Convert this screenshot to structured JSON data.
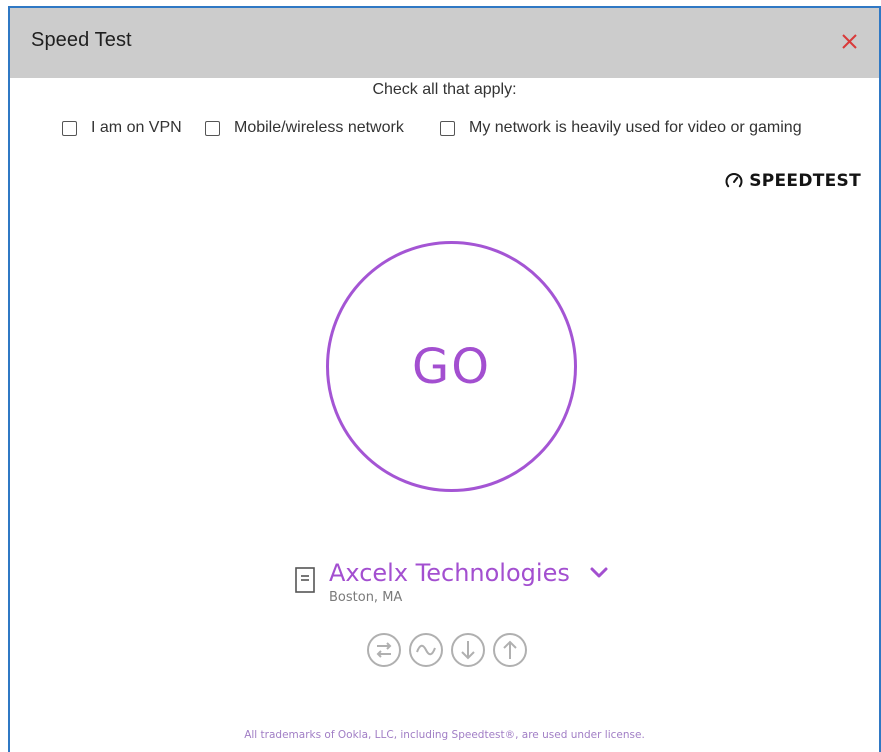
{
  "dialog": {
    "title": "Speed Test",
    "close_icon": "close-icon"
  },
  "instructions": "Check all that apply:",
  "options": [
    {
      "label": "I am on VPN",
      "checked": false
    },
    {
      "label": "Mobile/wireless network",
      "checked": false
    },
    {
      "label": "My network is heavily used for video or gaming",
      "checked": false
    }
  ],
  "brand": {
    "text": "SPEEDTEST",
    "mark": "˙",
    "icon": "speedometer-icon"
  },
  "go_button": {
    "label": "GO"
  },
  "server": {
    "name": "Axcelx Technologies",
    "location": "Boston, MA",
    "icon": "server-document-icon",
    "dropdown_icon": "chevron-down-icon"
  },
  "test_icons": [
    {
      "icon": "ping-icon"
    },
    {
      "icon": "jitter-icon"
    },
    {
      "icon": "download-icon"
    },
    {
      "icon": "upload-icon"
    }
  ],
  "footer": "All trademarks of Ookla, LLC, including Speedtest®, are used under license.",
  "colors": {
    "accent": "#a34fd0",
    "title_bar": "#cccccc",
    "window_border": "#2f78c4",
    "close": "#d93a3a",
    "icon_gray": "#b0b0b0"
  }
}
